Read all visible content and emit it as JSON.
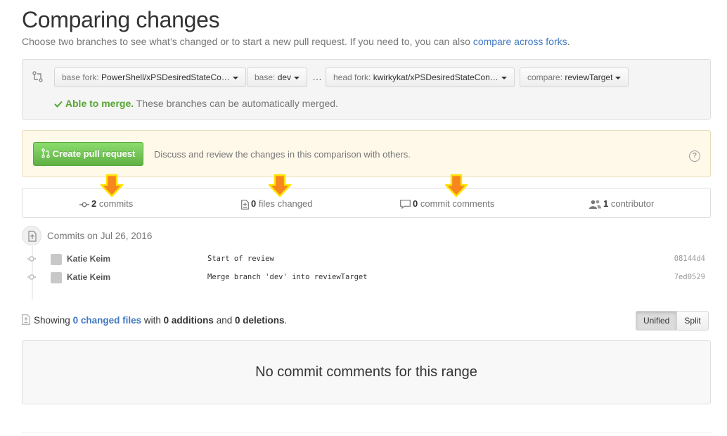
{
  "header": {
    "title": "Comparing changes",
    "subtitle_prefix": "Choose two branches to see what’s changed or to start a new pull request. If you need to, you can also ",
    "subtitle_link": "compare across forks",
    "subtitle_suffix": "."
  },
  "range": {
    "base_fork_label": "base fork:",
    "base_fork_value": "PowerShell/xPSDesiredStateCo…",
    "base_label": "base:",
    "base_value": "dev",
    "separator": "…",
    "head_fork_label": "head fork:",
    "head_fork_value": "kwirkykat/xPSDesiredStateCon…",
    "compare_label": "compare:",
    "compare_value": "reviewTarget",
    "merge_status": "Able to merge.",
    "merge_detail": "These branches can be automatically merged."
  },
  "pull_request": {
    "button_label": "Create pull request",
    "description": "Discuss and review the changes in this comparison with others.",
    "help_glyph": "?"
  },
  "numbers": {
    "commits_count": "2",
    "commits_label": "commits",
    "files_count": "0",
    "files_label": "files changed",
    "comments_count": "0",
    "comments_label": "commit comments",
    "contributors_count": "1",
    "contributors_label": "contributor"
  },
  "commits": {
    "date_label": "Commits on Jul 26, 2016",
    "rows": [
      {
        "author": "Katie Keim",
        "message": "Start of review",
        "sha": "08144d4"
      },
      {
        "author": "Katie Keim",
        "message": "Merge branch 'dev' into reviewTarget",
        "sha": "7ed0529"
      }
    ]
  },
  "files": {
    "showing": "Showing",
    "changed_link": "0 changed files",
    "with": "with",
    "additions": "0 additions",
    "and": "and",
    "deletions": "0 deletions",
    "period": ".",
    "view_unified": "Unified",
    "view_split": "Split"
  },
  "comments": {
    "blankslate": "No commit comments for this range"
  },
  "colors": {
    "link": "#4078c0",
    "success": "#55a532",
    "annotation_arrow": "#f7861f",
    "annotation_outline": "#ffe400"
  }
}
